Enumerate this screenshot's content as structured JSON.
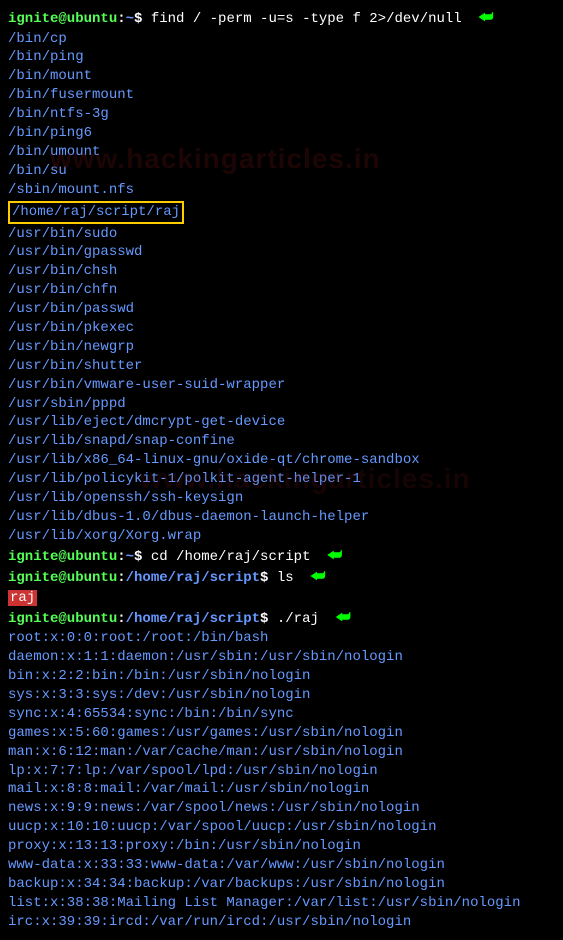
{
  "watermark": "www.hackingarticles.in",
  "prompt1": {
    "user": "ignite@ubuntu",
    "path": "~",
    "cmd": "find / -perm -u=s -type f 2>/dev/null"
  },
  "find_output": [
    "/bin/cp",
    "/bin/ping",
    "/bin/mount",
    "/bin/fusermount",
    "/bin/ntfs-3g",
    "/bin/ping6",
    "/bin/umount",
    "/bin/su",
    "/sbin/mount.nfs"
  ],
  "highlighted_path": "/home/raj/script/raj",
  "find_output2": [
    "/usr/bin/sudo",
    "/usr/bin/gpasswd",
    "/usr/bin/chsh",
    "/usr/bin/chfn",
    "/usr/bin/passwd",
    "/usr/bin/pkexec",
    "/usr/bin/newgrp",
    "/usr/bin/shutter",
    "/usr/bin/vmware-user-suid-wrapper",
    "/usr/sbin/pppd",
    "/usr/lib/eject/dmcrypt-get-device",
    "/usr/lib/snapd/snap-confine",
    "/usr/lib/x86_64-linux-gnu/oxide-qt/chrome-sandbox",
    "/usr/lib/policykit-1/polkit-agent-helper-1",
    "/usr/lib/openssh/ssh-keysign",
    "/usr/lib/dbus-1.0/dbus-daemon-launch-helper",
    "/usr/lib/xorg/Xorg.wrap"
  ],
  "prompt2": {
    "user": "ignite@ubuntu",
    "path": "~",
    "cmd": "cd /home/raj/script"
  },
  "prompt3": {
    "user": "ignite@ubuntu",
    "path": "/home/raj/script",
    "cmd": "ls"
  },
  "ls_output": "raj",
  "prompt4": {
    "user": "ignite@ubuntu",
    "path": "/home/raj/script",
    "cmd": "./raj"
  },
  "raj_output": [
    "root:x:0:0:root:/root:/bin/bash",
    "daemon:x:1:1:daemon:/usr/sbin:/usr/sbin/nologin",
    "bin:x:2:2:bin:/bin:/usr/sbin/nologin",
    "sys:x:3:3:sys:/dev:/usr/sbin/nologin",
    "sync:x:4:65534:sync:/bin:/bin/sync",
    "games:x:5:60:games:/usr/games:/usr/sbin/nologin",
    "man:x:6:12:man:/var/cache/man:/usr/sbin/nologin",
    "lp:x:7:7:lp:/var/spool/lpd:/usr/sbin/nologin",
    "mail:x:8:8:mail:/var/mail:/usr/sbin/nologin",
    "news:x:9:9:news:/var/spool/news:/usr/sbin/nologin",
    "uucp:x:10:10:uucp:/var/spool/uucp:/usr/sbin/nologin",
    "proxy:x:13:13:proxy:/bin:/usr/sbin/nologin",
    "www-data:x:33:33:www-data:/var/www:/usr/sbin/nologin",
    "backup:x:34:34:backup:/var/backups:/usr/sbin/nologin",
    "list:x:38:38:Mailing List Manager:/var/list:/usr/sbin/nologin",
    "irc:x:39:39:ircd:/var/run/ircd:/usr/sbin/nologin"
  ]
}
